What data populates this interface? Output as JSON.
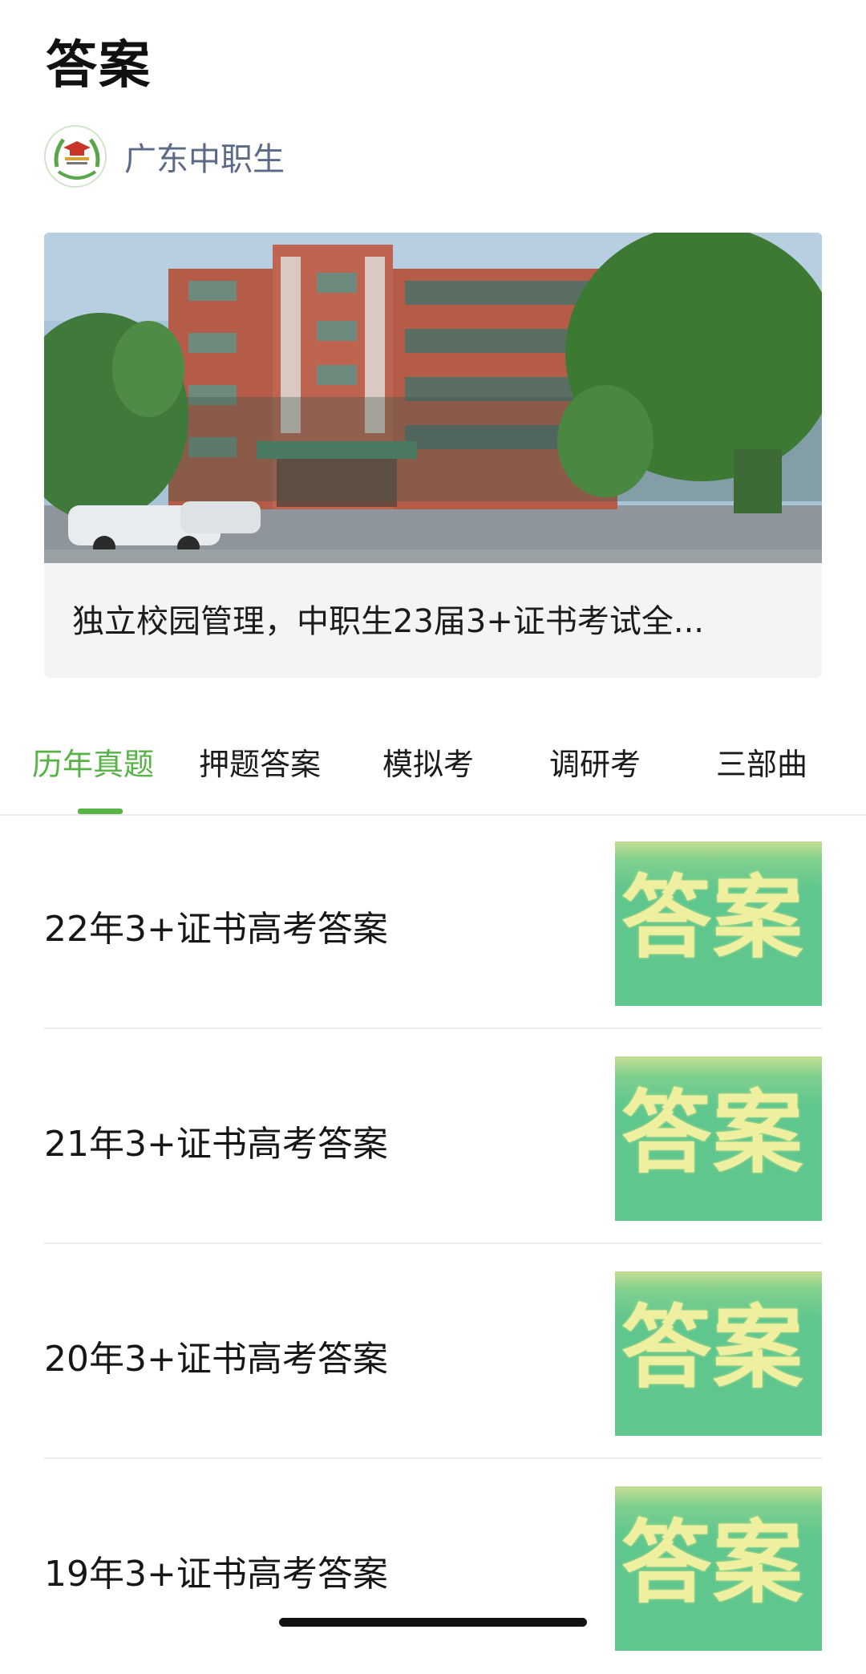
{
  "header": {
    "title": "答案"
  },
  "account": {
    "name": "广东中职生",
    "avatar_icon": "school-logo-icon"
  },
  "banner": {
    "caption": "独立校园管理，中职生23届3+证书考试全..."
  },
  "tabs": [
    {
      "label": "历年真题",
      "active": true
    },
    {
      "label": "押题答案",
      "active": false
    },
    {
      "label": "模拟考",
      "active": false
    },
    {
      "label": "调研考",
      "active": false
    },
    {
      "label": "三部曲",
      "active": false
    }
  ],
  "articles": [
    {
      "title": "22年3+证书高考答案",
      "thumb_text": "答案"
    },
    {
      "title": "21年3+证书高考答案",
      "thumb_text": "答案"
    },
    {
      "title": "20年3+证书高考答案",
      "thumb_text": "答案"
    },
    {
      "title": "19年3+证书高考答案",
      "thumb_text": "答案"
    }
  ],
  "colors": {
    "accent": "#57b345",
    "thumb_bg": "#5fc68e",
    "thumb_text": "#eef0a0"
  }
}
